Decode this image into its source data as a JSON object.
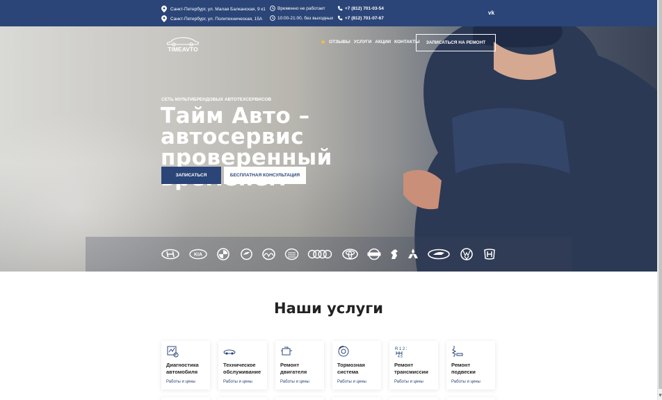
{
  "topbar": {
    "addresses": [
      "Санкт-Петербург, ул. Малая Балканская, 9 к1",
      "Санкт-Петербург, ул. Политехническая, 15А"
    ],
    "hours": [
      "Временно не работает",
      "10:00-21:00, без выходных"
    ],
    "phones": [
      "+7 (812) 701-03-54",
      "+7 (812) 701-07-67"
    ],
    "social": "vk"
  },
  "logo": {
    "text": "TIMEAVTO"
  },
  "nav": {
    "items": [
      "Отзывы",
      "Услуги",
      "Акции",
      "Контакты"
    ],
    "cta": "Записаться на ремонт"
  },
  "hero": {
    "eyebrow": "Сеть мультибрендовых автотехсервисов",
    "title": "Тайм Авто – автосервис проверенный временем",
    "btn_primary": "Записаться",
    "btn_secondary": "Бесплатная консультация"
  },
  "brands": [
    "hyundai",
    "kia",
    "bmw",
    "skoda",
    "mazda",
    "lifan",
    "audi",
    "toyota",
    "nissan",
    "peugeot",
    "mitsubishi",
    "lada",
    "volkswagen",
    "honda"
  ],
  "services": {
    "title": "Наши услуги",
    "link_label": "Работы и цены",
    "items": [
      {
        "title": "Диагностика автомобиля",
        "icon": "diagnostics-icon"
      },
      {
        "title": "Техническое обслуживание",
        "icon": "maintenance-icon"
      },
      {
        "title": "Ремонт двигателя",
        "icon": "engine-icon"
      },
      {
        "title": "Тормозная система",
        "icon": "brake-icon"
      },
      {
        "title": "Ремонт трансмиссии",
        "icon": "gearbox-icon"
      },
      {
        "title": "Ремонт подвески",
        "icon": "suspension-icon"
      }
    ]
  }
}
